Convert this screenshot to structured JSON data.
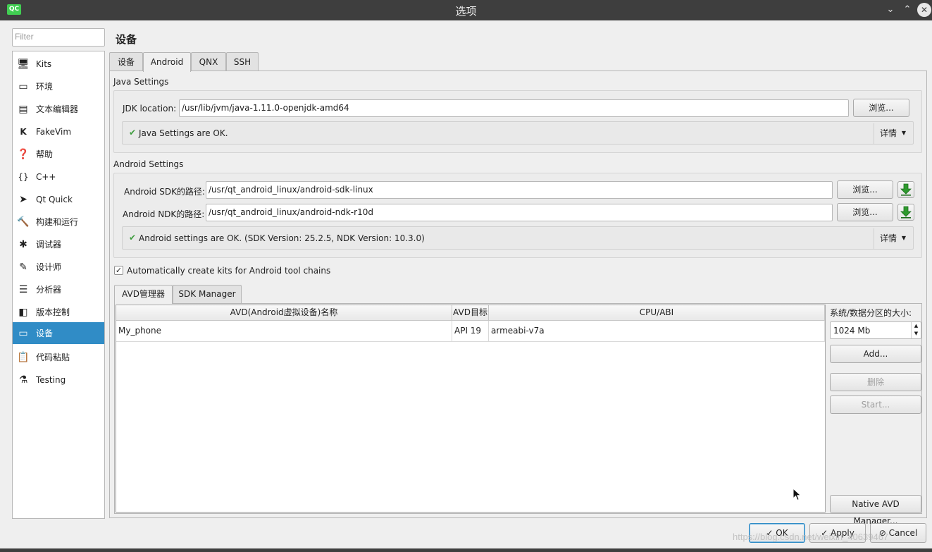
{
  "window": {
    "app_icon_text": "QC",
    "title": "选项",
    "minimize_glyph": "⌄",
    "maximize_glyph": "⌃",
    "close_glyph": "✕"
  },
  "sidebar": {
    "filter_placeholder": "Filter",
    "items": [
      {
        "label": "Kits",
        "icon": "kits-icon",
        "glyph": "🖥"
      },
      {
        "label": "环境",
        "icon": "monitor-icon",
        "glyph": "▭"
      },
      {
        "label": "文本编辑器",
        "icon": "text-editor-icon",
        "glyph": "▤"
      },
      {
        "label": "FakeVim",
        "icon": "fakevim-icon",
        "glyph": "K"
      },
      {
        "label": "帮助",
        "icon": "help-icon",
        "glyph": "❓"
      },
      {
        "label": "C++",
        "icon": "braces-icon",
        "glyph": "{}"
      },
      {
        "label": "Qt Quick",
        "icon": "qt-quick-icon",
        "glyph": "➤"
      },
      {
        "label": "构建和运行",
        "icon": "hammer-icon",
        "glyph": "🔨"
      },
      {
        "label": "调试器",
        "icon": "bug-icon",
        "glyph": "✱"
      },
      {
        "label": "设计师",
        "icon": "pencil-icon",
        "glyph": "✎"
      },
      {
        "label": "分析器",
        "icon": "analyzer-icon",
        "glyph": "☰"
      },
      {
        "label": "版本控制",
        "icon": "version-control-icon",
        "glyph": "◧"
      },
      {
        "label": "设备",
        "icon": "device-icon",
        "glyph": "▭",
        "selected": true
      },
      {
        "label": "代码粘贴",
        "icon": "clipboard-icon",
        "glyph": "📋"
      },
      {
        "label": "Testing",
        "icon": "flask-icon",
        "glyph": "⚗"
      }
    ]
  },
  "page": {
    "title": "设备",
    "tabs": [
      "设备",
      "Android",
      "QNX",
      "SSH"
    ],
    "active_tab": "Android"
  },
  "java": {
    "section_title": "Java Settings",
    "jdk_label": "JDK location:",
    "jdk_value": "/usr/lib/jvm/java-1.11.0-openjdk-amd64",
    "browse_label": "浏览...",
    "status_text": "Java Settings are OK.",
    "details_label": "详情"
  },
  "android": {
    "section_title": "Android Settings",
    "sdk_label": "Android SDK的路径:",
    "sdk_value": "/usr/qt_android_linux/android-sdk-linux",
    "ndk_label": "Android NDK的路径:",
    "ndk_value": "/usr/qt_android_linux/android-ndk-r10d",
    "browse_label": "浏览...",
    "status_text": "Android settings are OK. (SDK Version: 25.2.5, NDK Version: 10.3.0)",
    "details_label": "详情",
    "auto_kits_label": "Automatically create kits for Android tool chains",
    "auto_kits_checked": true
  },
  "avd": {
    "tabs": [
      "AVD管理器",
      "SDK Manager"
    ],
    "active_tab": "AVD管理器",
    "columns": [
      "AVD(Android虚拟设备)名称",
      "AVD目标",
      "CPU/ABI"
    ],
    "rows": [
      {
        "name": "My_phone",
        "target": "API 19",
        "abi": "armeabi-v7a"
      }
    ],
    "partition_label": "系统/数据分区的大小:",
    "partition_value": "1024 Mb",
    "add_label": "Add...",
    "remove_label": "删除",
    "start_label": "Start...",
    "native_label": "Native AVD Manager..."
  },
  "dialog": {
    "ok_label": "OK",
    "apply_label": "Apply",
    "cancel_label": "Cancel"
  },
  "watermark": "https://blog.csdn.net/weixin_40639467",
  "colors": {
    "selection": "#308cc6",
    "titlebar": "#3e3e3e",
    "ok_check": "#3d9c3d",
    "download_arrow": "#2e9a2e"
  }
}
